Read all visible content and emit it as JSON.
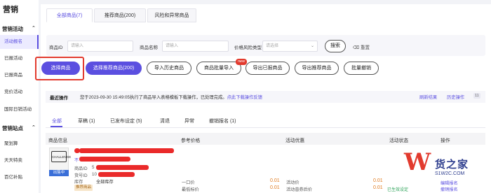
{
  "app": {
    "title": "营销"
  },
  "sidebar": {
    "sections": [
      {
        "label": "营销活动",
        "items": [
          "活动报名",
          "已报活动",
          "已报商品",
          "竞价活动",
          "国际日销活动"
        ]
      },
      {
        "label": "营销站点",
        "items": [
          "聚划算",
          "天天特卖",
          "百亿补贴"
        ]
      }
    ],
    "active_item": "活动报名"
  },
  "tabs": [
    "全部商品(7)",
    "推荐商品(200)",
    "风险和异常商品"
  ],
  "filters": {
    "id_label": "商品ID",
    "id_placeholder": "请输入",
    "name_label": "商品名称",
    "name_placeholder": "请输入",
    "risk_label": "价格风险类型",
    "risk_placeholder": "请选择",
    "search_label": "搜索",
    "reset_label": "重置"
  },
  "actions": {
    "select_goods": "选择商品",
    "select_recommended": "选择推荐商品(200)",
    "import_history": "导入历史商品",
    "batch_import": "商品批量导入",
    "new_badge": "new",
    "export_reported": "导出已报商品",
    "export_recommended": "导出推荐商品",
    "batch_cancel": "批量撤销"
  },
  "recent": {
    "label": "最近操作",
    "text": "您于2023-09-30 15:49:05执行了商品导入表格模板下载操作，已处理完成。",
    "link": "点此下载操作反馈",
    "refresh": "刷新结果",
    "history": "历史操作",
    "count": "11"
  },
  "status_tabs": [
    "全部",
    "草稿 (1)",
    "已发布设定 (5)",
    "清退",
    "异常",
    "撤销报名 (1)"
  ],
  "table": {
    "headers": [
      "商品信息",
      "参考价格",
      "活动优惠",
      "活动状态",
      "操作"
    ],
    "row": {
      "thumb_logo": "CHALLENGE",
      "sale_badge": "出售中",
      "title_prefix": "不",
      "id_label": "商品ID",
      "id_value": "5",
      "sku_label": "货号ID",
      "sku_value": "10",
      "stock_label": "库存",
      "stock_value": "全部库存",
      "rec_tag": "推荐商品",
      "price_label_1": "一口价",
      "price_label_2": "最低标价",
      "price_value_1": "0.01",
      "price_value_2": "0.01",
      "promo_label_1": "活动价",
      "promo_label_2": "活动普券后价",
      "promo_value_1": "0.01",
      "promo_value_2": "0.01",
      "status": "已生效设定",
      "op_1": "编辑报名",
      "op_2": "撤销报名"
    }
  },
  "watermark": {
    "mark": "W",
    "name": "货之家",
    "url": "S1W2C.COM"
  }
}
